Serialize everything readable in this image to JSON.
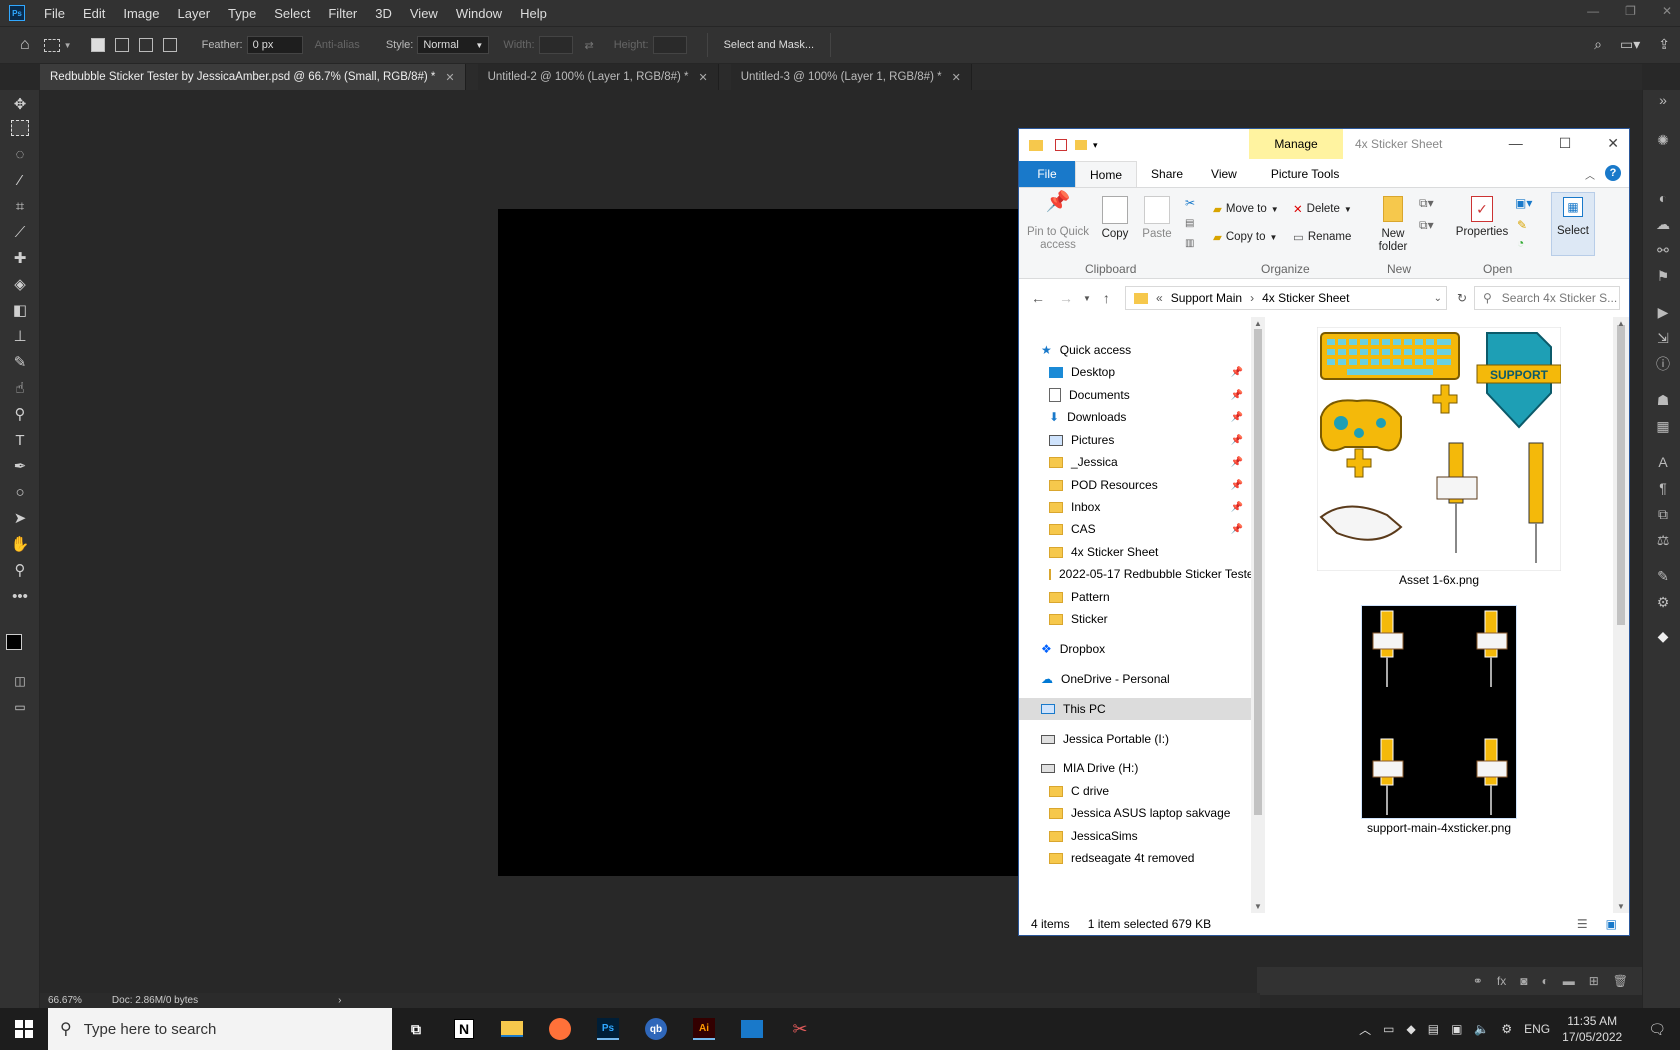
{
  "menubar": {
    "logo": "Ps",
    "items": [
      "File",
      "Edit",
      "Image",
      "Layer",
      "Type",
      "Select",
      "Filter",
      "3D",
      "View",
      "Window",
      "Help"
    ]
  },
  "options": {
    "feather_label": "Feather:",
    "feather_value": "0 px",
    "antialias_label": "Anti-alias",
    "style_label": "Style:",
    "style_value": "Normal",
    "width_label": "Width:",
    "height_label": "Height:",
    "select_mask": "Select and Mask..."
  },
  "tabs": [
    {
      "label": "Redbubble Sticker Tester by JessicaAmber.psd @ 66.7% (Small, RGB/8#) *",
      "active": true
    },
    {
      "label": "Untitled-2 @ 100% (Layer 1, RGB/8#) *",
      "active": false
    },
    {
      "label": "Untitled-3 @ 100% (Layer 1, RGB/8#) *",
      "active": false
    }
  ],
  "status": {
    "zoom": "66.67%",
    "doc": "Doc: 2.86M/0 bytes"
  },
  "explorer": {
    "manage": "Manage",
    "title": "4x Sticker Sheet",
    "ribbon_tabs": [
      "File",
      "Home",
      "Share",
      "View",
      "Picture Tools"
    ],
    "ribbon": {
      "pin": "Pin to Quick access",
      "copy": "Copy",
      "paste": "Paste",
      "clipboard": "Clipboard",
      "move_to": "Move to",
      "copy_to": "Copy to",
      "delete": "Delete",
      "rename": "Rename",
      "organize": "Organize",
      "new_folder": "New folder",
      "new": "New",
      "properties": "Properties",
      "open": "Open",
      "select": "Select"
    },
    "breadcrumb": [
      "Support Main",
      "4x Sticker Sheet"
    ],
    "search_placeholder": "Search 4x Sticker S...",
    "nav": [
      {
        "label": "Quick access",
        "type": "quick"
      },
      {
        "label": "Desktop",
        "type": "desk",
        "pinned": true
      },
      {
        "label": "Documents",
        "type": "docs",
        "pinned": true
      },
      {
        "label": "Downloads",
        "type": "down",
        "pinned": true
      },
      {
        "label": "Pictures",
        "type": "pics",
        "pinned": true
      },
      {
        "label": "_Jessica",
        "type": "folder",
        "pinned": true
      },
      {
        "label": "POD Resources",
        "type": "folder",
        "pinned": true
      },
      {
        "label": "Inbox",
        "type": "folder",
        "pinned": true
      },
      {
        "label": "CAS",
        "type": "folder",
        "pinned": true
      },
      {
        "label": "4x Sticker Sheet",
        "type": "folder"
      },
      {
        "label": "2022-05-17 Redbubble Sticker Teste",
        "type": "folder"
      },
      {
        "label": "Pattern",
        "type": "folder"
      },
      {
        "label": "Sticker",
        "type": "folder"
      },
      {
        "label": "Dropbox",
        "type": "dropbox"
      },
      {
        "label": "OneDrive - Personal",
        "type": "onedrive"
      },
      {
        "label": "This PC",
        "type": "pc"
      },
      {
        "label": "Jessica Portable (I:)",
        "type": "drive"
      },
      {
        "label": "MIA Drive (H:)",
        "type": "drive"
      },
      {
        "label": "C drive",
        "type": "folder"
      },
      {
        "label": "Jessica ASUS laptop sakvage",
        "type": "folder"
      },
      {
        "label": "JessicaSims",
        "type": "folder"
      },
      {
        "label": "redseagate 4t removed",
        "type": "folder"
      }
    ],
    "files": [
      {
        "name": "Asset 1-6x.png",
        "selected": false
      },
      {
        "name": "support-main-4xsticker.png",
        "selected": true
      }
    ],
    "thumb_text": "SUPPORT",
    "status_items": "4 items",
    "status_selected": "1 item selected  679 KB"
  },
  "taskbar": {
    "search_placeholder": "Type here to search",
    "lang": "ENG",
    "time": "11:35 AM",
    "date": "17/05/2022"
  }
}
